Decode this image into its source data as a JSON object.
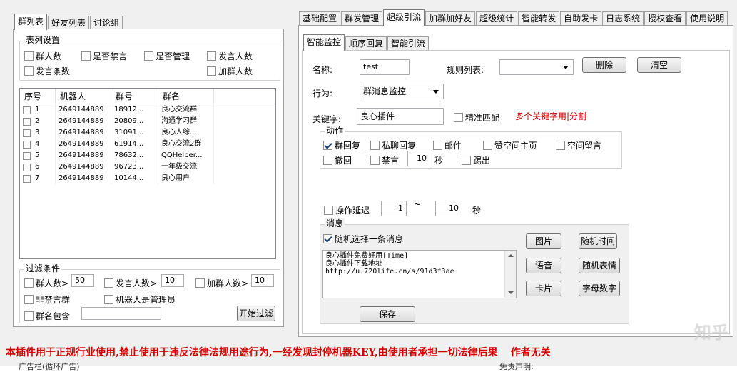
{
  "left_tabs": [
    "群列表",
    "好友列表",
    "讨论组"
  ],
  "list_settings": {
    "title": "表列设置",
    "options": [
      {
        "label": "群人数",
        "checked": false
      },
      {
        "label": "是否禁言",
        "checked": false
      },
      {
        "label": "是否管理",
        "checked": false
      },
      {
        "label": "发言人数",
        "checked": false
      },
      {
        "label": "发言条数",
        "checked": false
      },
      {
        "label": "加群人数",
        "checked": false
      }
    ]
  },
  "group_list": {
    "headers": [
      "序号",
      "机器人",
      "群号",
      "群名"
    ],
    "rows": [
      {
        "index": "1",
        "robot": "2649144889",
        "group_no": "18912...",
        "name": "良心交流群"
      },
      {
        "index": "2",
        "robot": "2649144889",
        "group_no": "20809...",
        "name": "沟通学习群"
      },
      {
        "index": "3",
        "robot": "2649144889",
        "group_no": "31091...",
        "name": "良心人综..."
      },
      {
        "index": "4",
        "robot": "2649144889",
        "group_no": "61914...",
        "name": "良心交流2群"
      },
      {
        "index": "5",
        "robot": "2649144889",
        "group_no": "78632...",
        "name": "QQHelper..."
      },
      {
        "index": "6",
        "robot": "2649144889",
        "group_no": "96723...",
        "name": "一年级交流"
      },
      {
        "index": "7",
        "robot": "2649144889",
        "group_no": "10144...",
        "name": "良心用户"
      }
    ]
  },
  "filter": {
    "title": "过滤条件",
    "members_label": "群人数>",
    "members_value": "50",
    "speakers_label": "发言人数>",
    "speakers_value": "10",
    "joins_label": "加群人数>",
    "joins_value": "10",
    "not_muted_label": "非禁言群",
    "robot_admin_label": "机器人是管理员",
    "name_contains_label": "群名包含",
    "name_contains_value": "",
    "start_button": "开始过滤"
  },
  "top_tabs": [
    "基础配置",
    "群发管理",
    "超级引流",
    "加群加好友",
    "超级统计",
    "智能转发",
    "自助发卡",
    "日志系统",
    "授权查看",
    "使用说明"
  ],
  "top_tab_active": 2,
  "sub_tabs": [
    "智能监控",
    "顺序回复",
    "智能引流"
  ],
  "sub_tab_active": 0,
  "form": {
    "name_label": "名称:",
    "name_value": "test",
    "rules_label": "规则列表:",
    "rules_value": "",
    "delete_button": "删除",
    "clear_button": "清空",
    "action_label": "行为:",
    "action_value": "群消息监控",
    "keyword_label": "关键字:",
    "keyword_value": "良心插件",
    "exact_match_label": "精准匹配",
    "keyword_tip": "多个关键字用|分割"
  },
  "actions": {
    "title": "动作",
    "group_reply": "群回复",
    "private_reply": "私聊回复",
    "email": "邮件",
    "like_zone": "赞空间主页",
    "zone_message": "空间留言",
    "recall": "撤回",
    "mute": "禁言",
    "mute_seconds": "10",
    "seconds_unit": "秒",
    "kick": "踢出"
  },
  "delay": {
    "label": "操作延迟",
    "from": "1",
    "separator": "~",
    "to": "10",
    "unit": "秒"
  },
  "message": {
    "title": "消息",
    "random_label": "随机选择一条消息",
    "lines": [
      "良心插件免费好用[Time]",
      "良心插件下载地址",
      "http://u.720life.cn/s/91d3f3ae"
    ],
    "buttons": [
      "图片",
      "随机时间",
      "语音",
      "随机表情",
      "卡片",
      "字母数字"
    ]
  },
  "save_button": "保存",
  "warning": "本插件用于正规行业使用,禁止使用于违反法律法规用途行为,一经发现封停机器KEY,由使用者承担一切法律后果",
  "warning_tail": "作者无关",
  "watermark": "知乎",
  "footer_left": "广告栏(循环广告)",
  "footer_right": "免责声明:"
}
